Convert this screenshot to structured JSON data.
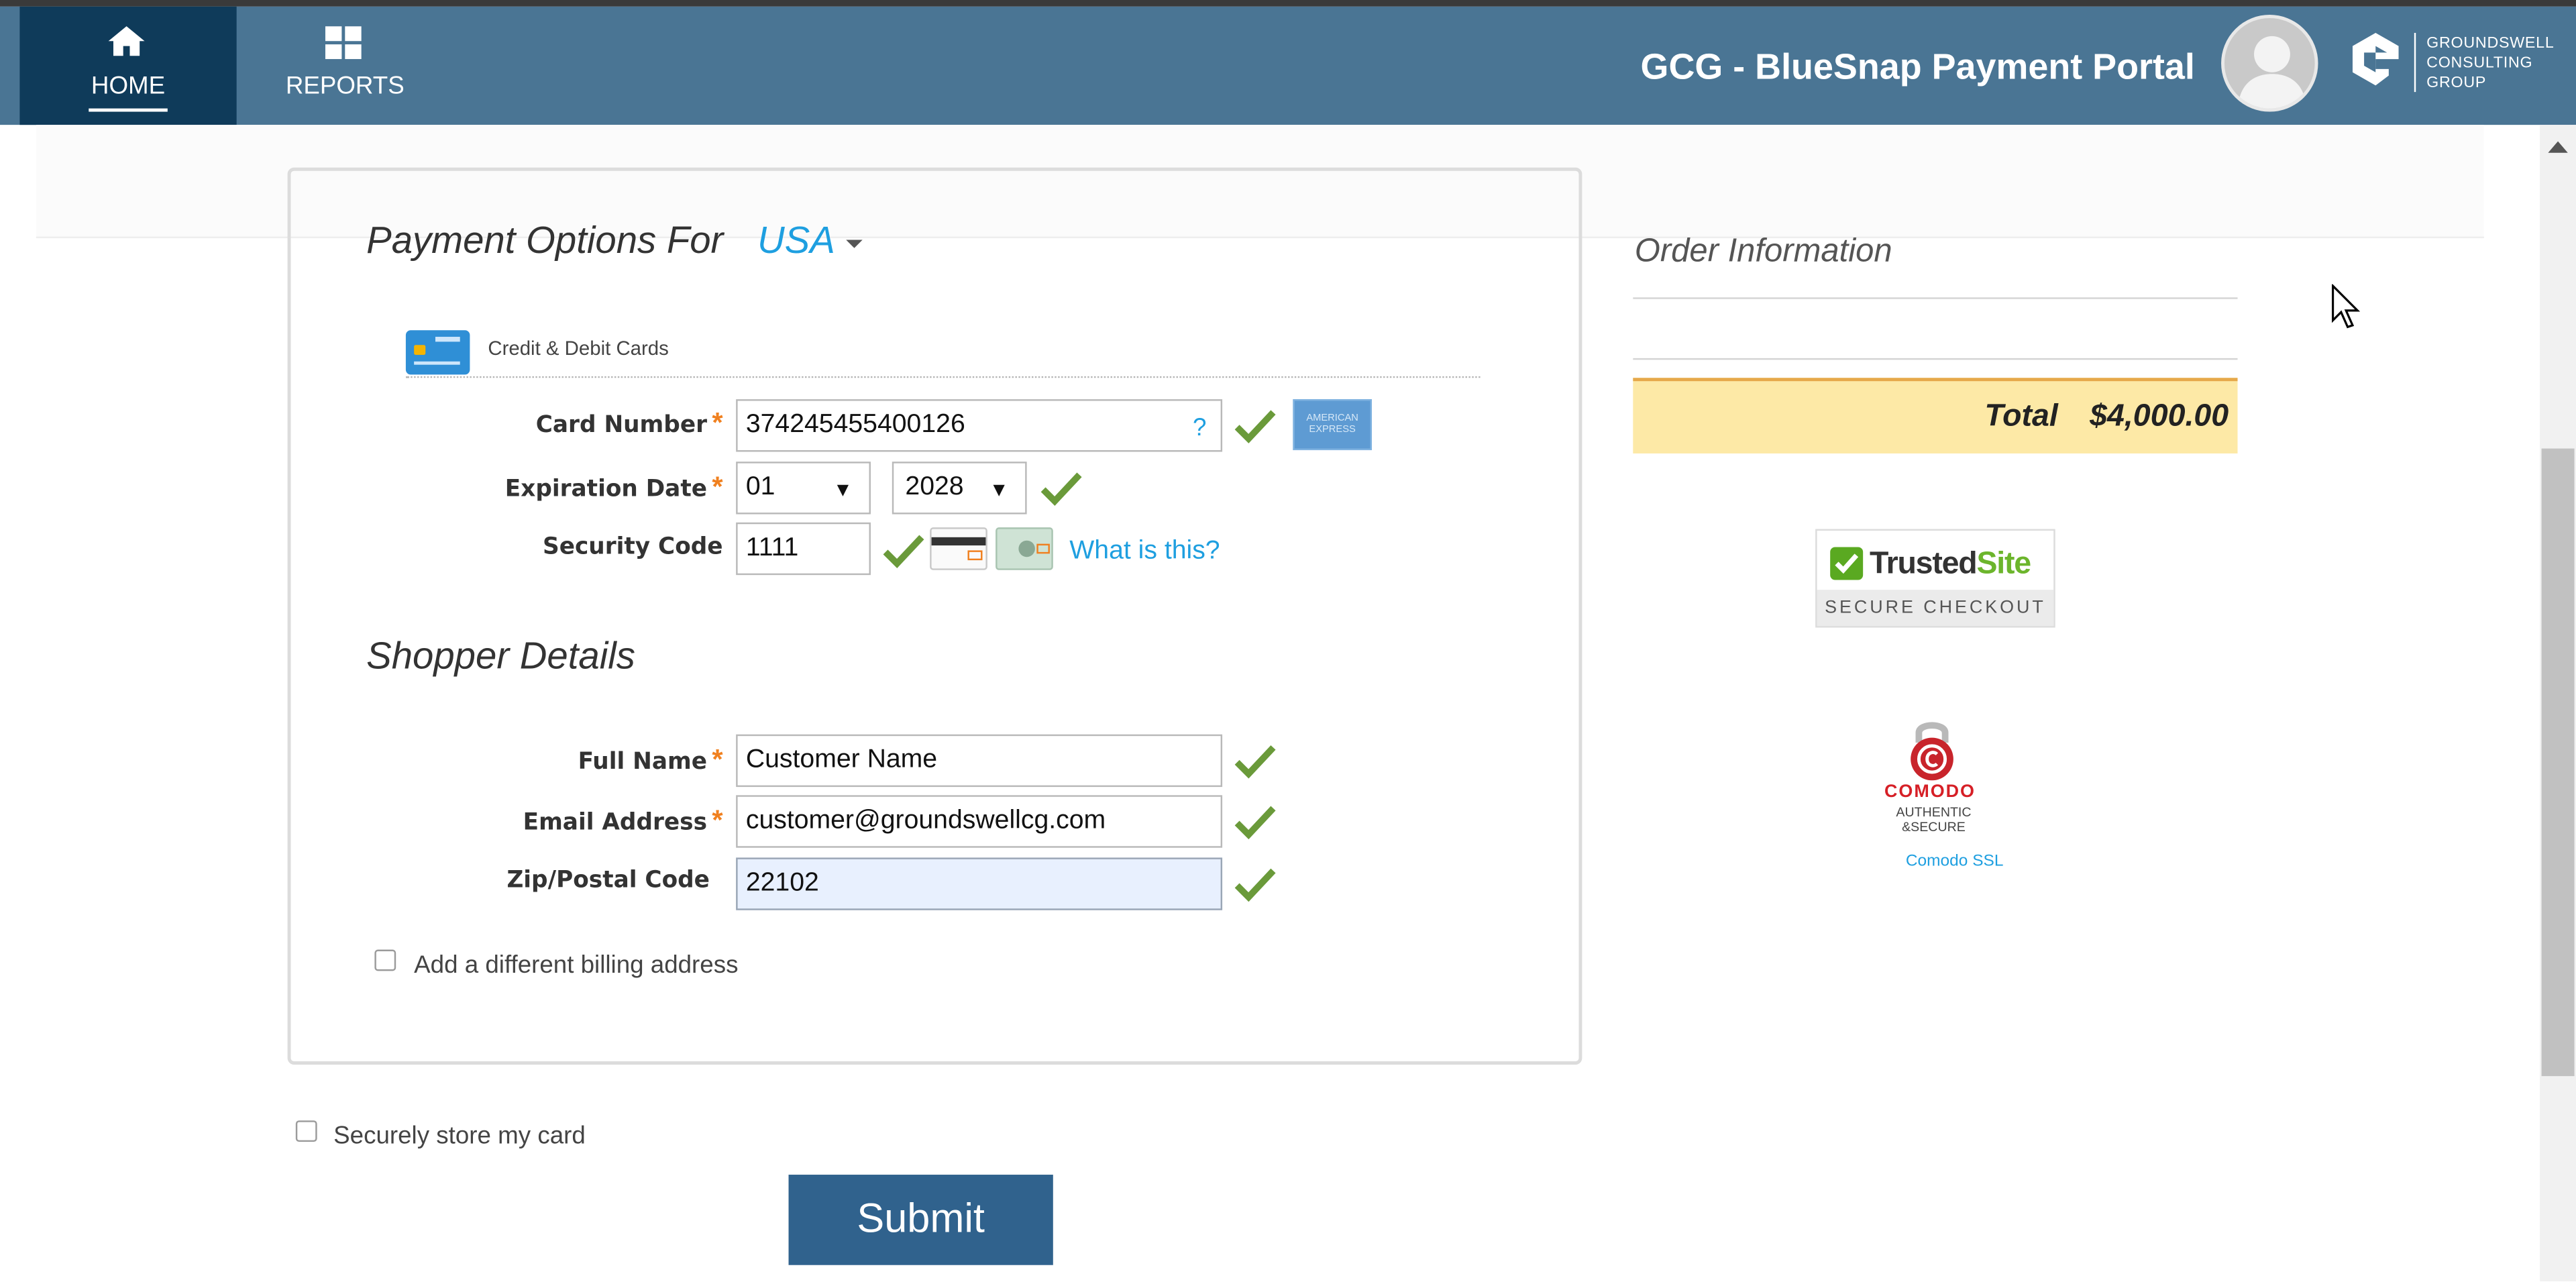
{
  "nav": {
    "home_label": "HOME",
    "reports_label": "REPORTS",
    "portal_title": "GCG - BlueSnap Payment Portal",
    "logo_lines": [
      "GROUNDSWELL",
      "CONSULTING",
      "GROUP"
    ]
  },
  "payment": {
    "title": "Payment Options For",
    "country": "USA",
    "method_tab": "Credit & Debit Cards",
    "card_number": {
      "label": "Card Number",
      "value": "374245455400126",
      "help": "?"
    },
    "expiration": {
      "label": "Expiration Date",
      "month": "01",
      "year": "2028"
    },
    "security": {
      "label": "Security Code",
      "value": "1111",
      "help_link": "What is this?"
    },
    "card_brand": "AMERICAN EXPRESS"
  },
  "shopper": {
    "title": "Shopper Details",
    "full_name": {
      "label": "Full Name",
      "value": "Customer Name"
    },
    "email": {
      "label": "Email Address",
      "value": "customer@groundswellcg.com"
    },
    "zip": {
      "label": "Zip/Postal Code",
      "value": "22102"
    },
    "billing_checkbox": "Add a different billing address"
  },
  "store_card_checkbox": "Securely store my card",
  "submit_label": "Submit",
  "order": {
    "title": "Order Information",
    "total_label": "Total",
    "total_value": "$4,000.00"
  },
  "badges": {
    "trusted_brand_a": "Trusted",
    "trusted_brand_b": "Site",
    "trusted_sub": "SECURE CHECKOUT",
    "comodo_word": "COMODO",
    "comodo_sub": "AUTHENTIC &SECURE",
    "comodo_link": "Comodo SSL"
  },
  "colors": {
    "nav_bg": "#4a7594",
    "nav_active": "#0f3b5a",
    "accent_link": "#1e9fe0",
    "required": "#f0801f",
    "total_bg": "#fde9a6",
    "submit_bg": "#30628d",
    "valid_check": "#6a9a3a"
  }
}
